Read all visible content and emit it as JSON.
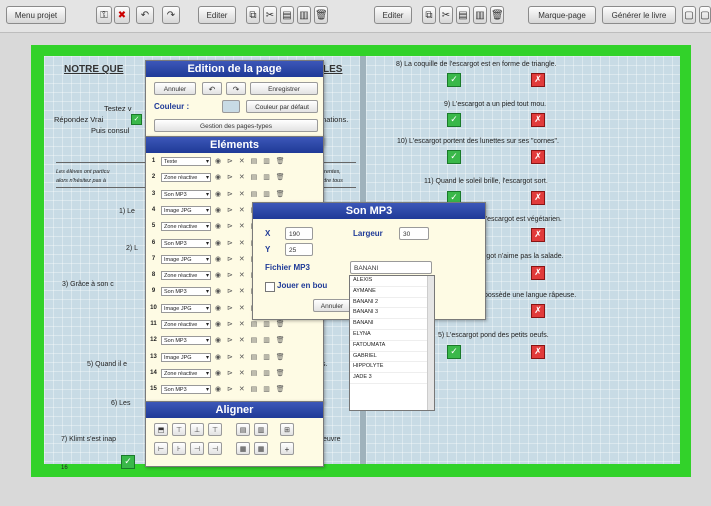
{
  "toolbar": {
    "menu_projet": "Menu projet",
    "editer1": "Editer",
    "editer2": "Editer",
    "marque_page": "Marque-page",
    "generer": "Générer le livre"
  },
  "left_page": {
    "title": "NOTRE QUE",
    "title_end": "LES",
    "intro1": "Testez v",
    "intro2": "Répondez Vrai",
    "intro2_end": "mations.",
    "intro3": "Puis consul",
    "note1": "Les élèves ont particu",
    "note1_end": "rentes,",
    "note2": "alors n'hésitez pas à",
    "note2_end": "ndre tous",
    "q1": "1) Le",
    "q2": "2) L",
    "q3": "3) Grâce à son c",
    "q5": "5) Quand il e",
    "q5_end": "s.",
    "q6": "6) Les",
    "q7": "7) Klimt s'est inap",
    "q7_end": "euvre",
    "page_number": "16"
  },
  "right_page": {
    "q8": "8) La coquille de l'escargot est en forme de triangle.",
    "q9": "9) L'escargot a un pied tout mou.",
    "q10": "10) L'escargot portent des lunettes sur ses \"cornes\".",
    "q11": "11) Quand le soleil brille, l'escargot sort.",
    "q12": "r l'escargot est végétarien.",
    "q13": "rgot n'aime pas la salade.",
    "q14": "possède une langue râpeuse.",
    "q15": "5) L'escargot pond des petits oeufs."
  },
  "edition_panel": {
    "title": "Edition de la page",
    "annuler": "Annuler",
    "enregistrer": "Enregistrer",
    "couleur_label": "Couleur :",
    "couleur_defaut": "Couleur par défaut",
    "gestion": "Gestion des pages-types",
    "elements_title": "Eléments",
    "aligner_title": "Aligner",
    "rows": [
      {
        "n": "1",
        "type": "Texte"
      },
      {
        "n": "2",
        "type": "Zone réactive"
      },
      {
        "n": "3",
        "type": "Son MP3"
      },
      {
        "n": "4",
        "type": "Image JPG"
      },
      {
        "n": "5",
        "type": "Zone réactive"
      },
      {
        "n": "6",
        "type": "Son MP3"
      },
      {
        "n": "7",
        "type": "Image JPG"
      },
      {
        "n": "8",
        "type": "Zone réactive"
      },
      {
        "n": "9",
        "type": "Son MP3"
      },
      {
        "n": "10",
        "type": "Image JPG"
      },
      {
        "n": "11",
        "type": "Zone réactive"
      },
      {
        "n": "12",
        "type": "Son MP3"
      },
      {
        "n": "13",
        "type": "Image JPG"
      },
      {
        "n": "14",
        "type": "Zone réactive"
      },
      {
        "n": "15",
        "type": "Son MP3"
      }
    ]
  },
  "mp3_dialog": {
    "title": "Son MP3",
    "x_label": "X",
    "x_value": "190",
    "y_label": "Y",
    "y_value": "25",
    "largeur_label": "Largeur",
    "largeur_value": "30",
    "fichier_label": "Fichier MP3",
    "fichier_value": "BANANI",
    "jouer_label": "Jouer en bou",
    "annuler": "Annuler",
    "options": [
      "ALEXIS",
      "AYMANE",
      "BANANI 2",
      "BANANI 3",
      "BANANI",
      "ELYNA",
      "FATOUMATA",
      "GABRIEL",
      "HIPPOLYTE",
      "JADE 3"
    ]
  }
}
